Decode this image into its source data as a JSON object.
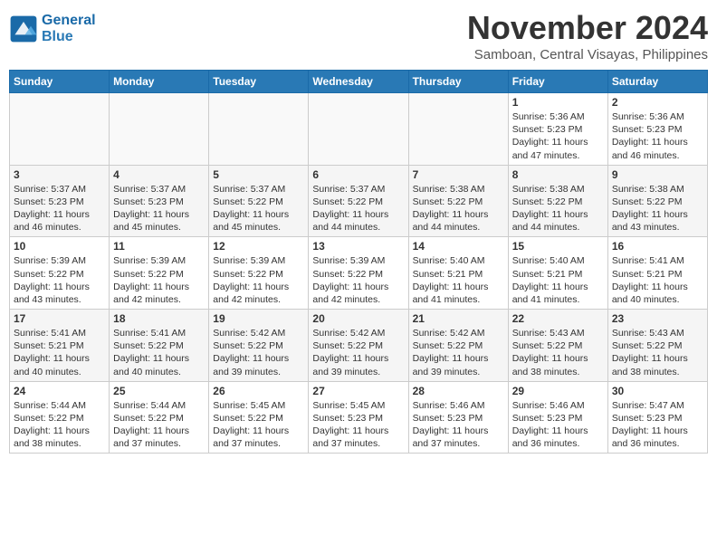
{
  "header": {
    "logo_line1": "General",
    "logo_line2": "Blue",
    "month_title": "November 2024",
    "location": "Samboan, Central Visayas, Philippines"
  },
  "days_of_week": [
    "Sunday",
    "Monday",
    "Tuesday",
    "Wednesday",
    "Thursday",
    "Friday",
    "Saturday"
  ],
  "weeks": [
    [
      {
        "day": "",
        "info": ""
      },
      {
        "day": "",
        "info": ""
      },
      {
        "day": "",
        "info": ""
      },
      {
        "day": "",
        "info": ""
      },
      {
        "day": "",
        "info": ""
      },
      {
        "day": "1",
        "info": "Sunrise: 5:36 AM\nSunset: 5:23 PM\nDaylight: 11 hours and 47 minutes."
      },
      {
        "day": "2",
        "info": "Sunrise: 5:36 AM\nSunset: 5:23 PM\nDaylight: 11 hours and 46 minutes."
      }
    ],
    [
      {
        "day": "3",
        "info": "Sunrise: 5:37 AM\nSunset: 5:23 PM\nDaylight: 11 hours and 46 minutes."
      },
      {
        "day": "4",
        "info": "Sunrise: 5:37 AM\nSunset: 5:23 PM\nDaylight: 11 hours and 45 minutes."
      },
      {
        "day": "5",
        "info": "Sunrise: 5:37 AM\nSunset: 5:22 PM\nDaylight: 11 hours and 45 minutes."
      },
      {
        "day": "6",
        "info": "Sunrise: 5:37 AM\nSunset: 5:22 PM\nDaylight: 11 hours and 44 minutes."
      },
      {
        "day": "7",
        "info": "Sunrise: 5:38 AM\nSunset: 5:22 PM\nDaylight: 11 hours and 44 minutes."
      },
      {
        "day": "8",
        "info": "Sunrise: 5:38 AM\nSunset: 5:22 PM\nDaylight: 11 hours and 44 minutes."
      },
      {
        "day": "9",
        "info": "Sunrise: 5:38 AM\nSunset: 5:22 PM\nDaylight: 11 hours and 43 minutes."
      }
    ],
    [
      {
        "day": "10",
        "info": "Sunrise: 5:39 AM\nSunset: 5:22 PM\nDaylight: 11 hours and 43 minutes."
      },
      {
        "day": "11",
        "info": "Sunrise: 5:39 AM\nSunset: 5:22 PM\nDaylight: 11 hours and 42 minutes."
      },
      {
        "day": "12",
        "info": "Sunrise: 5:39 AM\nSunset: 5:22 PM\nDaylight: 11 hours and 42 minutes."
      },
      {
        "day": "13",
        "info": "Sunrise: 5:39 AM\nSunset: 5:22 PM\nDaylight: 11 hours and 42 minutes."
      },
      {
        "day": "14",
        "info": "Sunrise: 5:40 AM\nSunset: 5:21 PM\nDaylight: 11 hours and 41 minutes."
      },
      {
        "day": "15",
        "info": "Sunrise: 5:40 AM\nSunset: 5:21 PM\nDaylight: 11 hours and 41 minutes."
      },
      {
        "day": "16",
        "info": "Sunrise: 5:41 AM\nSunset: 5:21 PM\nDaylight: 11 hours and 40 minutes."
      }
    ],
    [
      {
        "day": "17",
        "info": "Sunrise: 5:41 AM\nSunset: 5:21 PM\nDaylight: 11 hours and 40 minutes."
      },
      {
        "day": "18",
        "info": "Sunrise: 5:41 AM\nSunset: 5:22 PM\nDaylight: 11 hours and 40 minutes."
      },
      {
        "day": "19",
        "info": "Sunrise: 5:42 AM\nSunset: 5:22 PM\nDaylight: 11 hours and 39 minutes."
      },
      {
        "day": "20",
        "info": "Sunrise: 5:42 AM\nSunset: 5:22 PM\nDaylight: 11 hours and 39 minutes."
      },
      {
        "day": "21",
        "info": "Sunrise: 5:42 AM\nSunset: 5:22 PM\nDaylight: 11 hours and 39 minutes."
      },
      {
        "day": "22",
        "info": "Sunrise: 5:43 AM\nSunset: 5:22 PM\nDaylight: 11 hours and 38 minutes."
      },
      {
        "day": "23",
        "info": "Sunrise: 5:43 AM\nSunset: 5:22 PM\nDaylight: 11 hours and 38 minutes."
      }
    ],
    [
      {
        "day": "24",
        "info": "Sunrise: 5:44 AM\nSunset: 5:22 PM\nDaylight: 11 hours and 38 minutes."
      },
      {
        "day": "25",
        "info": "Sunrise: 5:44 AM\nSunset: 5:22 PM\nDaylight: 11 hours and 37 minutes."
      },
      {
        "day": "26",
        "info": "Sunrise: 5:45 AM\nSunset: 5:22 PM\nDaylight: 11 hours and 37 minutes."
      },
      {
        "day": "27",
        "info": "Sunrise: 5:45 AM\nSunset: 5:23 PM\nDaylight: 11 hours and 37 minutes."
      },
      {
        "day": "28",
        "info": "Sunrise: 5:46 AM\nSunset: 5:23 PM\nDaylight: 11 hours and 37 minutes."
      },
      {
        "day": "29",
        "info": "Sunrise: 5:46 AM\nSunset: 5:23 PM\nDaylight: 11 hours and 36 minutes."
      },
      {
        "day": "30",
        "info": "Sunrise: 5:47 AM\nSunset: 5:23 PM\nDaylight: 11 hours and 36 minutes."
      }
    ]
  ]
}
